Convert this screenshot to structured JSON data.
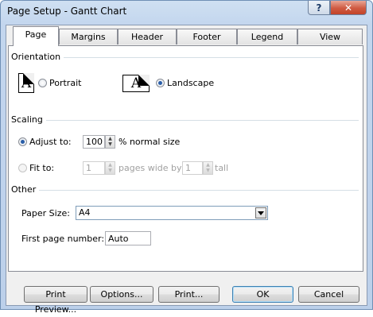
{
  "window": {
    "title": "Page Setup - Gantt Chart",
    "help_glyph": "?",
    "close_glyph": "✕"
  },
  "tabs": [
    "Page",
    "Margins",
    "Header",
    "Footer",
    "Legend",
    "View"
  ],
  "selected_tab": "Page",
  "orientation": {
    "group_title": "Orientation",
    "icon_glyph": "A",
    "portrait_label": "Portrait",
    "landscape_label": "Landscape",
    "selected": "Landscape"
  },
  "scaling": {
    "group_title": "Scaling",
    "adjust_to_label": "Adjust to:",
    "adjust_to_value": "100",
    "normal_size_label": "% normal size",
    "fit_to_label": "Fit to:",
    "pages_wide_value": "1",
    "pages_wide_label": "pages wide by",
    "tall_value": "1",
    "tall_label": "tall",
    "selected": "Adjust to"
  },
  "other": {
    "group_title": "Other",
    "paper_size_label": "Paper Size:",
    "paper_size_value": "A4",
    "first_page_label": "First page number:",
    "first_page_value": "Auto"
  },
  "buttons": {
    "print_preview": "Print Preview...",
    "options": "Options...",
    "print": "Print...",
    "ok": "OK",
    "cancel": "Cancel"
  },
  "colors": {
    "title_gradient_top": "#cfe0f2",
    "close_button_red": "#c34328",
    "radio_dot": "#2a5ea8"
  }
}
